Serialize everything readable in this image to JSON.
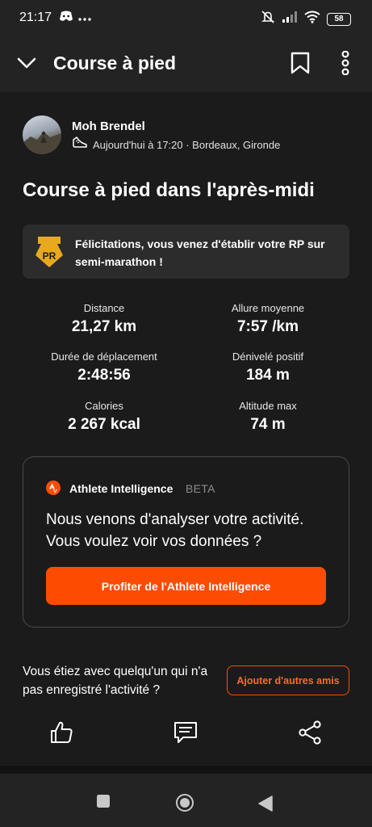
{
  "status_bar": {
    "time": "21:17",
    "battery": "58",
    "icons": [
      "discord-icon",
      "more-dots-icon",
      "mute-icon",
      "signal-icon",
      "wifi-icon",
      "battery-icon"
    ]
  },
  "app_bar": {
    "title": "Course à pied",
    "icons": [
      "chevron-down-icon",
      "bookmark-icon",
      "more-vertical-icon"
    ]
  },
  "athlete": {
    "name": "Moh Brendel",
    "meta": "Aujourd'hui à 17:20 · Bordeaux, Gironde",
    "meta_icon": "shoe-icon"
  },
  "activity": {
    "title": "Course à pied dans l'après-midi"
  },
  "pr_banner": {
    "badge": "PR",
    "text": "Félicitations, vous venez d'établir votre RP sur semi-marathon !"
  },
  "stats": [
    {
      "label": "Distance",
      "value": "21,27 km"
    },
    {
      "label": "Allure moyenne",
      "value": "7:57 /km"
    },
    {
      "label": "Durée de déplacement",
      "value": "2:48:56"
    },
    {
      "label": "Dénivelé positif",
      "value": "184 m"
    },
    {
      "label": "Calories",
      "value": "2 267 kcal"
    },
    {
      "label": "Altitude max",
      "value": "74 m"
    }
  ],
  "athlete_intelligence": {
    "name": "Athlete Intelligence",
    "beta": "BETA",
    "message": "Nous venons d'analyser votre activité. Vous voulez voir vos données ?",
    "cta": "Profiter de l'Athlete Intelligence"
  },
  "friends": {
    "text": "Vous étiez avec quelqu'un qui n'a pas enregistré l'activité ?",
    "button": "Ajouter d'autres amis"
  },
  "actions": [
    "like-icon",
    "comment-icon",
    "share-icon"
  ],
  "nav_bar": [
    "recents-icon",
    "home-icon",
    "back-icon"
  ],
  "colors": {
    "accent": "#fc4c02",
    "background": "#1b1b1b",
    "bar": "#232323",
    "pr_gold": "#e8a820"
  }
}
